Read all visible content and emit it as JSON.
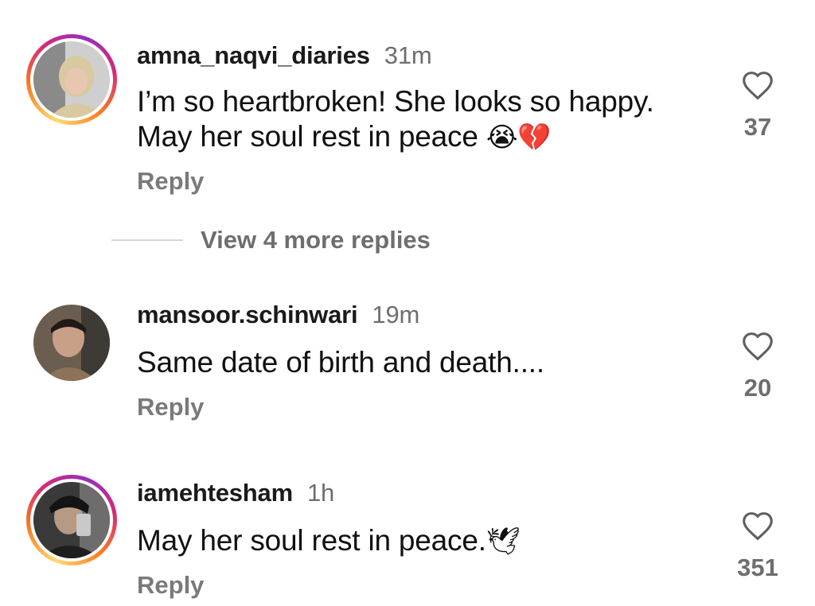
{
  "comments": [
    {
      "username": "amna_naqvi_diaries",
      "time": "31m",
      "text_line1": "I’m so heartbroken! She looks so happy.",
      "text_line2": "May her soul rest in peace",
      "emoji1": "😭",
      "emoji2": "💔",
      "reply_label": "Reply",
      "like_count": "37",
      "view_more_label": "View 4 more replies",
      "avatar_icon": "user-avatar-icon",
      "story_ring": true
    },
    {
      "username": "mansoor.schinwari",
      "time": "19m",
      "text": "Same date of birth and death....",
      "reply_label": "Reply",
      "like_count": "20",
      "avatar_icon": "user-avatar-icon",
      "story_ring": false
    },
    {
      "username": "iamehtesham",
      "time": "1h",
      "text": "May her soul rest in peace.",
      "emoji": "🕊",
      "reply_label": "Reply",
      "like_count": "351",
      "avatar_icon": "user-avatar-icon",
      "story_ring": true
    }
  ],
  "colors": {
    "text": "#111111",
    "secondary": "#6e6e6e",
    "reply": "#7a7a7a",
    "heart_stroke": "#5f5f5f"
  }
}
